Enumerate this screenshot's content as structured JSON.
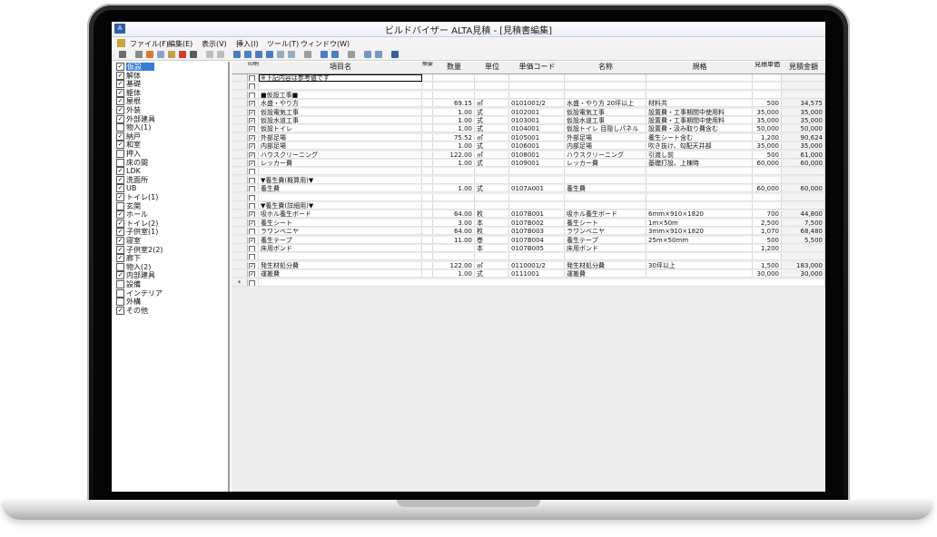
{
  "window": {
    "title": "ビルドバイザー ALTA見積 - [見積書編集]"
  },
  "menu": [
    "ファイル(F)",
    "編集(E)",
    "表示(V)",
    "挿入(I)",
    "ツール(T)",
    "ウィンドウ(W)"
  ],
  "tree": {
    "items": [
      {
        "label": "仮設",
        "checked": true,
        "selected": true
      },
      {
        "label": "解体",
        "checked": true
      },
      {
        "label": "基礎",
        "checked": true
      },
      {
        "label": "躯体",
        "checked": true
      },
      {
        "label": "屋根",
        "checked": true
      },
      {
        "label": "外装",
        "checked": true
      },
      {
        "label": "外部建具",
        "checked": true
      },
      {
        "label": "物入(1)",
        "checked": false
      },
      {
        "label": "納戸",
        "checked": true
      },
      {
        "label": "和室",
        "checked": true
      },
      {
        "label": "押入",
        "checked": false
      },
      {
        "label": "床の間",
        "checked": false
      },
      {
        "label": "LDK",
        "checked": true
      },
      {
        "label": "洗面所",
        "checked": true
      },
      {
        "label": "UB",
        "checked": true
      },
      {
        "label": "トイレ(1)",
        "checked": true
      },
      {
        "label": "玄関",
        "checked": false
      },
      {
        "label": "ホール",
        "checked": true
      },
      {
        "label": "トイレ(2)",
        "checked": true
      },
      {
        "label": "子供室(1)",
        "checked": true
      },
      {
        "label": "寝室",
        "checked": true
      },
      {
        "label": "子供室2(2)",
        "checked": true
      },
      {
        "label": "廊下",
        "checked": true
      },
      {
        "label": "物入(2)",
        "checked": false
      },
      {
        "label": "内部建具",
        "checked": true
      },
      {
        "label": "設備",
        "checked": false
      },
      {
        "label": "インテリア",
        "checked": false
      },
      {
        "label": "外構",
        "checked": false
      },
      {
        "label": "その他",
        "checked": true
      }
    ]
  },
  "grid": {
    "columns": [
      "印刷",
      "項目名",
      "摘要",
      "数量",
      "単位",
      "単価コード",
      "名称",
      "規格",
      "見積単価",
      "見積金額"
    ],
    "new_row_marker": "*",
    "rows": [
      {
        "chk": false,
        "item": "※下記内容は参考値です",
        "qty": "",
        "unit": "",
        "code": "",
        "name": "",
        "spec": "",
        "price": "",
        "amount": ""
      },
      {
        "chk": false,
        "item": "",
        "qty": "",
        "unit": "",
        "code": "",
        "name": "",
        "spec": "",
        "price": "",
        "amount": ""
      },
      {
        "chk": false,
        "item": "■仮設工事■",
        "qty": "",
        "unit": "",
        "code": "",
        "name": "",
        "spec": "",
        "price": "",
        "amount": ""
      },
      {
        "chk": true,
        "item": "水盛・やり方",
        "qty": "69.15",
        "unit": "㎡",
        "code": "0101001/2",
        "name": "水盛・やり方 20坪以上",
        "spec": "材料共",
        "price": "500",
        "amount": "34,575"
      },
      {
        "chk": true,
        "item": "仮設電気工事",
        "qty": "1.00",
        "unit": "式",
        "code": "0102001",
        "name": "仮設電気工事",
        "spec": "設置費・工事期間中使用料",
        "price": "35,000",
        "amount": "35,000"
      },
      {
        "chk": true,
        "item": "仮設水道工事",
        "qty": "1.00",
        "unit": "式",
        "code": "0103001",
        "name": "仮設水道工事",
        "spec": "設置費・工事期間中使用料",
        "price": "35,000",
        "amount": "35,000"
      },
      {
        "chk": true,
        "item": "仮設トイレ",
        "qty": "1.00",
        "unit": "式",
        "code": "0104001",
        "name": "仮設トイレ 目隠しパネル",
        "spec": "設置費・汲み取り費含む",
        "price": "50,000",
        "amount": "50,000"
      },
      {
        "chk": true,
        "item": "外部足場",
        "qty": "75.52",
        "unit": "㎡",
        "code": "0105001",
        "name": "外部足場",
        "spec": "養生シート含む",
        "price": "1,200",
        "amount": "90,624"
      },
      {
        "chk": true,
        "item": "内部足場",
        "qty": "1.00",
        "unit": "式",
        "code": "0106001",
        "name": "内部足場",
        "spec": "吹き抜け、勾配天井部",
        "price": "35,000",
        "amount": "35,000"
      },
      {
        "chk": true,
        "item": "ハウスクリーニング",
        "qty": "122.00",
        "unit": "㎡",
        "code": "0108001",
        "name": "ハウスクリーニング",
        "spec": "引渡し前",
        "price": "500",
        "amount": "61,000"
      },
      {
        "chk": true,
        "item": "レッカー費",
        "qty": "1.00",
        "unit": "式",
        "code": "0109001",
        "name": "レッカー費",
        "spec": "基礎打設、上棟時",
        "price": "60,000",
        "amount": "60,000"
      },
      {
        "chk": false,
        "item": "",
        "qty": "",
        "unit": "",
        "code": "",
        "name": "",
        "spec": "",
        "price": "",
        "amount": ""
      },
      {
        "chk": false,
        "item": "▼養生費(概算用)▼",
        "qty": "",
        "unit": "",
        "code": "",
        "name": "",
        "spec": "",
        "price": "",
        "amount": ""
      },
      {
        "chk": false,
        "item": "養生費",
        "qty": "1.00",
        "unit": "式",
        "code": "0107A001",
        "name": "養生費",
        "spec": "",
        "price": "60,000",
        "amount": "60,000"
      },
      {
        "chk": false,
        "item": "",
        "qty": "",
        "unit": "",
        "code": "",
        "name": "",
        "spec": "",
        "price": "",
        "amount": ""
      },
      {
        "chk": false,
        "item": "▼養生費(詳細用)▼",
        "qty": "",
        "unit": "",
        "code": "",
        "name": "",
        "spec": "",
        "price": "",
        "amount": ""
      },
      {
        "chk": true,
        "item": "吸ホル養生ボード",
        "qty": "64.00",
        "unit": "枚",
        "code": "0107B001",
        "name": "吸ホル養生ボード",
        "spec": "6mm×910×1820",
        "price": "700",
        "amount": "44,800"
      },
      {
        "chk": true,
        "item": "養生シート",
        "qty": "3.00",
        "unit": "本",
        "code": "0107B002",
        "name": "養生シート",
        "spec": "1m×50m",
        "price": "2,500",
        "amount": "7,500"
      },
      {
        "chk": false,
        "item": "ラワンベニヤ",
        "qty": "64.00",
        "unit": "枚",
        "code": "0107B003",
        "name": "ラワンベニヤ",
        "spec": "3mm×910×1820",
        "price": "1,070",
        "amount": "68,480"
      },
      {
        "chk": true,
        "item": "養生テープ",
        "qty": "11.00",
        "unit": "巻",
        "code": "0107B004",
        "name": "養生テープ",
        "spec": "25m×50mm",
        "price": "500",
        "amount": "5,500"
      },
      {
        "chk": false,
        "item": "床用ボンド",
        "qty": "",
        "unit": "本",
        "code": "0107B005",
        "name": "床用ボンド",
        "spec": "",
        "price": "1,200",
        "amount": ""
      },
      {
        "chk": false,
        "item": "",
        "qty": "",
        "unit": "",
        "code": "",
        "name": "",
        "spec": "",
        "price": "",
        "amount": ""
      },
      {
        "chk": true,
        "item": "発生材処分費",
        "qty": "122.00",
        "unit": "㎡",
        "code": "0110001/2",
        "name": "発生材処分費",
        "spec": "30坪以上",
        "price": "1,500",
        "amount": "183,000"
      },
      {
        "chk": true,
        "item": "運搬費",
        "qty": "1.00",
        "unit": "式",
        "code": "0111001",
        "name": "運搬費",
        "spec": "",
        "price": "30,000",
        "amount": "30,000"
      }
    ]
  }
}
